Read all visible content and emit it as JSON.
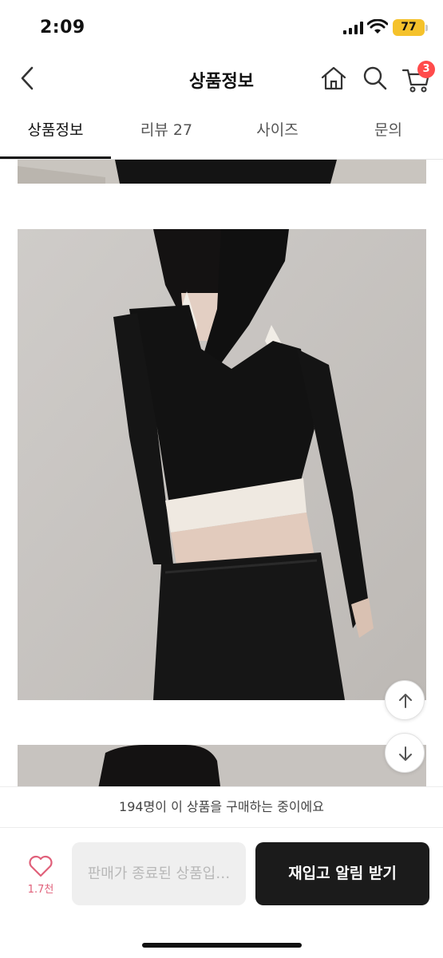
{
  "status_bar": {
    "time": "2:09",
    "battery": "77"
  },
  "header": {
    "title": "상품정보",
    "cart_count": "3"
  },
  "tabs": [
    {
      "label": "상품정보",
      "active": true
    },
    {
      "label": "리뷰 27",
      "active": false
    },
    {
      "label": "사이즈",
      "active": false
    },
    {
      "label": "문의",
      "active": false
    }
  ],
  "buyers_notice": "194명이 이 상품을 구매하는 중이에요",
  "bottom_bar": {
    "wish_count": "1.7천",
    "sold_out_label": "판매가 종료된 상품입…",
    "notify_label": "재입고 알림 받기"
  },
  "icons": [
    "back-icon",
    "home-icon",
    "search-icon",
    "cart-icon",
    "heart-icon",
    "arrow-up-icon",
    "arrow-down-icon"
  ],
  "colors": {
    "accent": "#ff4b4b",
    "primary_button": "#1b1b1b",
    "battery": "#f5c22b",
    "heart": "#e0607a"
  }
}
